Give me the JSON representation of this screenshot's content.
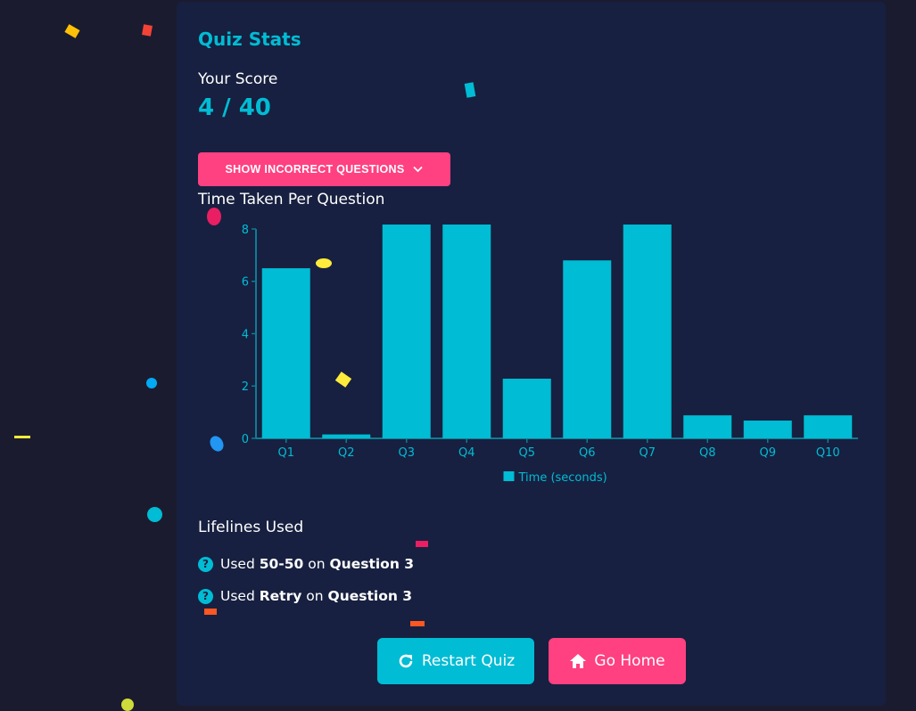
{
  "card": {
    "title": "Quiz Stats",
    "score_label": "Your Score",
    "score_value": "4 / 40",
    "toggle_label": "SHOW INCORRECT QUESTIONS"
  },
  "chart_data": {
    "type": "bar",
    "title": "Time Taken Per Question",
    "categories": [
      "Q1",
      "Q2",
      "Q3",
      "Q4",
      "Q5",
      "Q6",
      "Q7",
      "Q8",
      "Q9",
      "Q10"
    ],
    "series": [
      {
        "name": "Time (seconds)",
        "values": [
          6.5,
          0.15,
          8.17,
          8.17,
          2.28,
          6.8,
          8.17,
          0.88,
          0.68,
          0.88
        ],
        "color": "#00bcd4"
      }
    ],
    "yticks": [
      0,
      2,
      4,
      6,
      8
    ],
    "ylim": [
      0,
      8.17
    ],
    "legend": "bottom-center",
    "grid": false
  },
  "lifelines": {
    "title": "Lifelines Used",
    "items": [
      {
        "prefix": "Used",
        "lifeline": "50-50",
        "mid": "on",
        "question": "Question 3"
      },
      {
        "prefix": "Used",
        "lifeline": "Retry",
        "mid": "on",
        "question": "Question 3"
      }
    ]
  },
  "actions": {
    "restart_label": "Restart Quiz",
    "home_label": "Go Home"
  },
  "colors": {
    "accent": "#00bcd4",
    "pink": "#ff4081",
    "card": "#172040",
    "background": "#1b1b2f"
  }
}
